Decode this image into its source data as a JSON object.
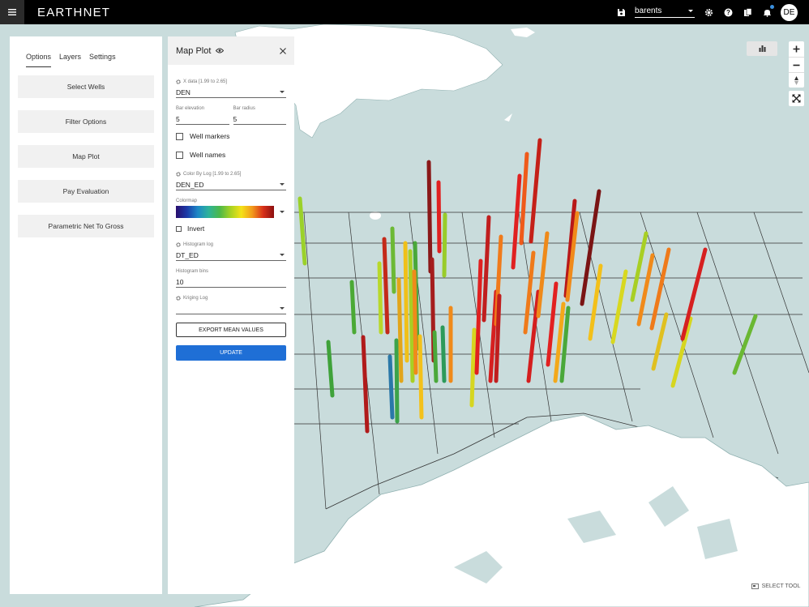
{
  "app": {
    "logo": "EARTHNET"
  },
  "header": {
    "project": "barents",
    "avatar_initials": "DE"
  },
  "tabs": [
    {
      "label": "Options"
    },
    {
      "label": "Layers"
    },
    {
      "label": "Settings"
    }
  ],
  "options": [
    {
      "label": "Select Wells"
    },
    {
      "label": "Filter Options"
    },
    {
      "label": "Map Plot"
    },
    {
      "label": "Pay Evaluation"
    },
    {
      "label": "Parametric Net To Gross"
    }
  ],
  "map_plot": {
    "title": "Map Plot",
    "x_data_label": "X data [1.99 to 2.65]",
    "x_data_value": "DEN",
    "bar_elevation_label": "Bar elevation",
    "bar_elevation_value": "5",
    "bar_radius_label": "Bar radius",
    "bar_radius_value": "5",
    "well_markers_label": "Well markers",
    "well_names_label": "Well names",
    "color_by_log_label": "Color By Log [1.99 to 2.65]",
    "color_by_log_value": "DEN_ED",
    "colormap_label": "Colormap",
    "invert_label": "Invert",
    "histogram_log_label": "Histogram log",
    "histogram_log_value": "DT_ED",
    "histogram_bins_label": "Histogram bins",
    "histogram_bins_value": "10",
    "kriging_log_label": "Kriging Log",
    "kriging_log_value": "",
    "export_label": "EXPORT MEAN VALUES",
    "update_label": "UPDATE"
  },
  "map_controls": {
    "select_tool_label": "SELECT TOOL"
  },
  "colors": {
    "accent": "#1f6fd6",
    "topbar": "#000000",
    "sea": "#c9dcdc",
    "land": "#ffffff"
  }
}
